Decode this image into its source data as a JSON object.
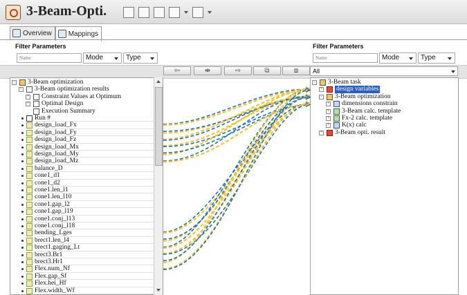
{
  "window": {
    "title": "3-Beam-Opti."
  },
  "toolbar": {
    "icons": [
      "edit-icon",
      "table-icon",
      "wand-icon",
      "hand-icon",
      "gear-icon"
    ]
  },
  "tabs": [
    {
      "label": "Overview",
      "icon": "overview-icon"
    },
    {
      "label": "Mappings",
      "icon": "mappings-icon"
    }
  ],
  "left_filter": {
    "title": "Filter Parameters",
    "name_placeholder": "Name",
    "mode": "Mode",
    "type": "Type"
  },
  "right_filter": {
    "title": "Filter Parameters",
    "name_placeholder": "Name",
    "mode": "Mode",
    "type": "Type"
  },
  "mapping_toolbar": {
    "buttons": [
      {
        "name": "map-left-button",
        "glyph": "⇦"
      },
      {
        "name": "map-both-button",
        "glyph": "⇼"
      },
      {
        "name": "map-right-button",
        "glyph": "⇨"
      },
      {
        "name": "copy-button",
        "glyph": "⧉"
      },
      {
        "name": "paste-button",
        "glyph": "⧈"
      }
    ],
    "filter_value": "All"
  },
  "left_tree": [
    {
      "label": "3-Beam optimization",
      "icon": "fold",
      "x": 2,
      "expander": "−"
    },
    {
      "label": "3-Beam optimization results",
      "icon": "doc",
      "x": 12,
      "expander": "−"
    },
    {
      "label": "Constraint Values at Optimum",
      "icon": "doc",
      "x": 22,
      "expander": "+"
    },
    {
      "label": "Optimal Design",
      "icon": "doc",
      "x": 22,
      "expander": "+"
    },
    {
      "label": "Execution Summary",
      "icon": "doc",
      "x": 22,
      "expander": ""
    },
    {
      "label": "Run #",
      "icon": "var",
      "x": 12,
      "bullet": true
    },
    {
      "label": "design_load_Fx",
      "icon": "cls",
      "x": 12,
      "bullet": true
    },
    {
      "label": "design_load_Fy",
      "icon": "cls",
      "x": 12,
      "bullet": true
    },
    {
      "label": "design_load_Fz",
      "icon": "cls",
      "x": 12,
      "bullet": true
    },
    {
      "label": "design_load_Mx",
      "icon": "cls",
      "x": 12,
      "bullet": true
    },
    {
      "label": "design_load_My",
      "icon": "cls",
      "x": 12,
      "bullet": true
    },
    {
      "label": "design_load_Mz",
      "icon": "cls",
      "x": 12,
      "bullet": true
    },
    {
      "label": "balance_D",
      "icon": "cls",
      "x": 12,
      "bullet": true
    },
    {
      "label": "cone1_d1",
      "icon": "cls",
      "x": 12,
      "bullet": true
    },
    {
      "label": "cone1_d2",
      "icon": "cls",
      "x": 12,
      "bullet": true
    },
    {
      "label": "cone1.len_l1",
      "icon": "cls",
      "x": 12,
      "bullet": true
    },
    {
      "label": "cone1.len_l10",
      "icon": "cls",
      "x": 12,
      "bullet": true
    },
    {
      "label": "cone1.gap_l2",
      "icon": "cls",
      "x": 12,
      "bullet": true
    },
    {
      "label": "cone1.gap_l19",
      "icon": "cls",
      "x": 12,
      "bullet": true
    },
    {
      "label": "cone1.conj_l13",
      "icon": "cls",
      "x": 12,
      "bullet": true
    },
    {
      "label": "cone1.conj_l18",
      "icon": "cls",
      "x": 12,
      "bullet": true
    },
    {
      "label": "bending_Lges",
      "icon": "cls",
      "x": 12,
      "bullet": true
    },
    {
      "label": "brect1.len_l4",
      "icon": "cls",
      "x": 12,
      "bullet": true
    },
    {
      "label": "brect1.gaging_Lt",
      "icon": "cls",
      "x": 12,
      "bullet": true
    },
    {
      "label": "brect3.Br1",
      "icon": "cls",
      "x": 12,
      "bullet": true
    },
    {
      "label": "brect3.Hr1",
      "icon": "cls",
      "x": 12,
      "bullet": true
    },
    {
      "label": "Flex.num_Nf",
      "icon": "cls",
      "x": 12,
      "bullet": true
    },
    {
      "label": "Flex.gap_Sf",
      "icon": "cls",
      "x": 12,
      "bullet": true
    },
    {
      "label": "Flex.hei_Hf",
      "icon": "cls",
      "x": 12,
      "bullet": true
    },
    {
      "label": "Flex.width_Wf",
      "icon": "cls",
      "x": 12,
      "bullet": true
    }
  ],
  "right_tree": [
    {
      "label": "3-Beam task",
      "icon": "fold",
      "x": 2,
      "expander": "−"
    },
    {
      "label": "design variables",
      "icon": "rd",
      "x": 12,
      "expander": "+",
      "selected": true
    },
    {
      "label": "3-Beam optimization",
      "icon": "fold",
      "x": 12,
      "expander": "−"
    },
    {
      "label": "dimensions constrain",
      "icon": "bl",
      "x": 22,
      "expander": "+"
    },
    {
      "label": "3-Beam calc. template",
      "icon": "gr",
      "x": 22,
      "expander": "+"
    },
    {
      "label": "Fx-2 calc. template",
      "icon": "gr",
      "x": 22,
      "expander": "+"
    },
    {
      "label": "K(x) calc",
      "icon": "bl",
      "x": 22,
      "expander": "+"
    },
    {
      "label": "3-Beam opti. result",
      "icon": "rd",
      "x": 12,
      "expander": "+"
    }
  ],
  "mappings": {
    "colors": {
      "blue": "#1f6fc2",
      "yellow": "#f4c430"
    },
    "links": [
      {
        "from": 6,
        "to": 1,
        "color": "blue"
      },
      {
        "from": 6,
        "to": 1,
        "color": "yellow"
      },
      {
        "from": 7,
        "to": 2,
        "color": "yellow"
      },
      {
        "from": 7,
        "to": 2,
        "color": "blue"
      },
      {
        "from": 8,
        "to": 1,
        "color": "yellow"
      },
      {
        "from": 8,
        "to": 2,
        "color": "blue"
      },
      {
        "from": 9,
        "to": 2,
        "color": "yellow"
      },
      {
        "from": 9,
        "to": 3,
        "color": "blue"
      },
      {
        "from": 10,
        "to": 1,
        "color": "yellow"
      },
      {
        "from": 10,
        "to": 3,
        "color": "blue"
      },
      {
        "from": 11,
        "to": 2,
        "color": "blue"
      },
      {
        "from": 11,
        "to": 3,
        "color": "yellow"
      },
      {
        "from": 21,
        "to": 3,
        "color": "blue"
      },
      {
        "from": 21,
        "to": 3,
        "color": "yellow"
      },
      {
        "from": 22,
        "to": 1,
        "color": "yellow"
      },
      {
        "from": 22,
        "to": 2,
        "color": "blue"
      },
      {
        "from": 23,
        "to": 1,
        "color": "blue"
      },
      {
        "from": 23,
        "to": 3,
        "color": "yellow"
      },
      {
        "from": 24,
        "to": 2,
        "color": "yellow"
      },
      {
        "from": 24,
        "to": 3,
        "color": "blue"
      },
      {
        "from": 25,
        "to": 1,
        "color": "yellow"
      },
      {
        "from": 25,
        "to": 2,
        "color": "blue"
      },
      {
        "from": 26,
        "to": 3,
        "color": "yellow"
      },
      {
        "from": 26,
        "to": 1,
        "color": "blue"
      }
    ]
  }
}
